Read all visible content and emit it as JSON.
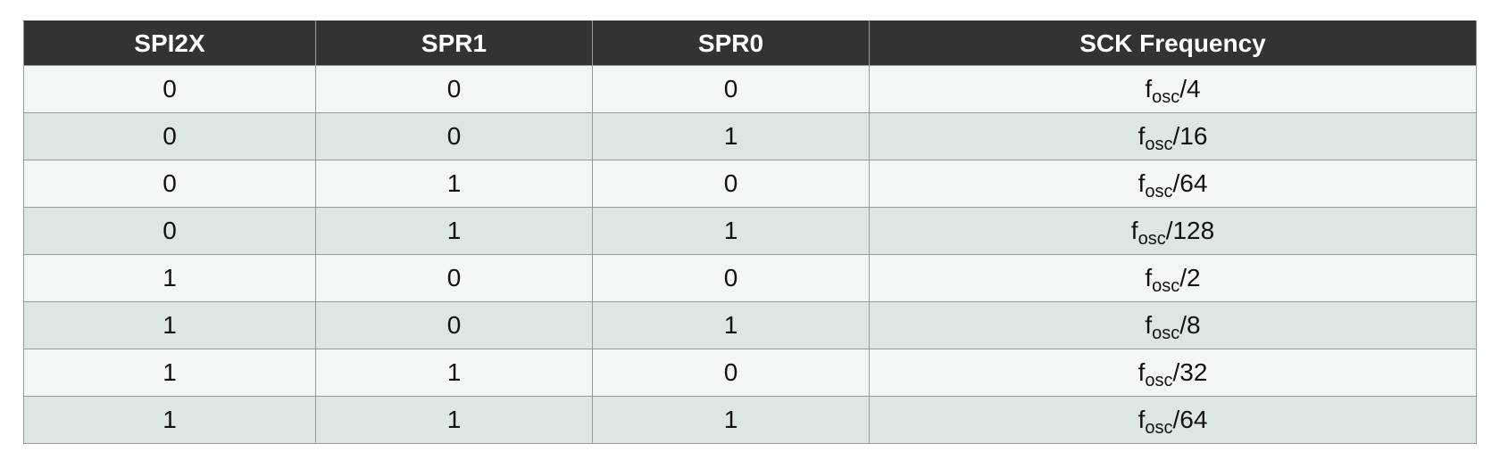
{
  "table": {
    "headers": [
      "SPI2X",
      "SPR1",
      "SPR0",
      "SCK Frequency"
    ],
    "rows": [
      {
        "spi2x": "0",
        "spr1": "0",
        "spr0": "0",
        "freq": {
          "base": "f",
          "sub": "osc",
          "div": "/4"
        }
      },
      {
        "spi2x": "0",
        "spr1": "0",
        "spr0": "1",
        "freq": {
          "base": "f",
          "sub": "osc",
          "div": "/16"
        }
      },
      {
        "spi2x": "0",
        "spr1": "1",
        "spr0": "0",
        "freq": {
          "base": "f",
          "sub": "osc",
          "div": "/64"
        }
      },
      {
        "spi2x": "0",
        "spr1": "1",
        "spr0": "1",
        "freq": {
          "base": "f",
          "sub": "osc",
          "div": "/128"
        }
      },
      {
        "spi2x": "1",
        "spr1": "0",
        "spr0": "0",
        "freq": {
          "base": "f",
          "sub": "osc",
          "div": "/2"
        }
      },
      {
        "spi2x": "1",
        "spr1": "0",
        "spr0": "1",
        "freq": {
          "base": "f",
          "sub": "osc",
          "div": "/8"
        }
      },
      {
        "spi2x": "1",
        "spr1": "1",
        "spr0": "0",
        "freq": {
          "base": "f",
          "sub": "osc",
          "div": "/32"
        }
      },
      {
        "spi2x": "1",
        "spr1": "1",
        "spr0": "1",
        "freq": {
          "base": "f",
          "sub": "osc",
          "div": "/64"
        }
      }
    ]
  },
  "colors": {
    "header_bg": "#333333",
    "header_text": "#ffffff",
    "row_light": "#f4f7f7",
    "row_dark": "#dde5e5",
    "border": "#9a9a9a"
  }
}
